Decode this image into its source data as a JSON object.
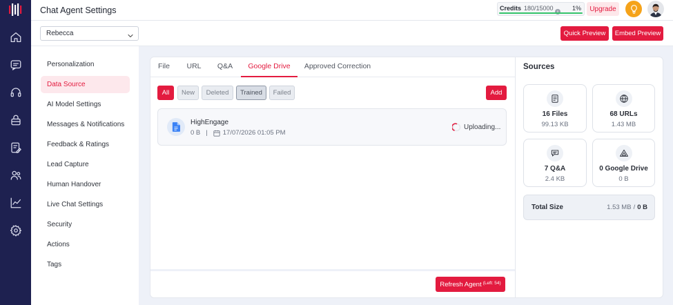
{
  "colors": {
    "primary": "#e31b3f",
    "active_bg": "#fde8ec",
    "sidebar": "#1e2150",
    "page_bg": "#eef1f8",
    "credit_bar": "#34c46a",
    "bulb": "#f5a31a"
  },
  "nav": {
    "logo": "logo-icon",
    "items": [
      {
        "icon": "home-icon"
      },
      {
        "icon": "chat-icon"
      },
      {
        "icon": "headset-icon"
      },
      {
        "icon": "bag-icon"
      },
      {
        "icon": "edit-document-icon"
      },
      {
        "icon": "users-icon"
      },
      {
        "icon": "analytics-icon"
      },
      {
        "icon": "gear-icon"
      }
    ]
  },
  "header": {
    "title": "Chat Agent Settings",
    "credits": {
      "label": "Credits",
      "value": "180/15000",
      "info_icon": "info-icon",
      "percent": "1%"
    },
    "upgrade_label": "Upgrade",
    "bulb_icon": "lightbulb-icon",
    "avatar_icon": "user-avatar"
  },
  "toolbar": {
    "agent_select": {
      "value": "Rebecca",
      "icon": "chevron-down-icon"
    },
    "quick_preview_label": "Quick Preview",
    "embed_preview_label": "Embed Preview"
  },
  "settings_menu": {
    "active_index": 1,
    "items": [
      "Personalization",
      "Data Source",
      "AI Model Settings",
      "Messages & Notifications",
      "Feedback & Ratings",
      "Lead Capture",
      "Human Handover",
      "Live Chat Settings",
      "Security",
      "Actions",
      "Tags"
    ]
  },
  "tabs": {
    "active_index": 3,
    "items": [
      "File",
      "URL",
      "Q&A",
      "Google Drive",
      "Approved Correction"
    ]
  },
  "filters": {
    "active_index": 0,
    "highlighted_index": 3,
    "items": [
      "All",
      "New",
      "Deleted",
      "Trained",
      "Failed"
    ]
  },
  "add_label": "Add",
  "files": {
    "items": [
      {
        "icon": "google-doc-icon",
        "name": "HighEngage",
        "size": "0 B",
        "separator": "|",
        "date_icon": "calendar-icon",
        "date": "17/07/2026 01:05 PM",
        "status_icon": "spinner-icon",
        "status": "Uploading..."
      }
    ]
  },
  "footer": {
    "refresh_label": "Refresh Agent",
    "refresh_remaining": "(Left: 54)"
  },
  "sources": {
    "title": "Sources",
    "cards": [
      {
        "icon": "file-icon",
        "count": "16 Files",
        "size": "99.13 KB"
      },
      {
        "icon": "globe-icon",
        "count": "68 URLs",
        "size": "1.43 MB"
      },
      {
        "icon": "qa-chat-icon",
        "count": "7 Q&A",
        "size": "2.4 KB"
      },
      {
        "icon": "google-drive-icon",
        "count": "0 Google Drive",
        "size": "0 B"
      }
    ],
    "total": {
      "label": "Total Size",
      "value": "1.53 MB",
      "separator": "/",
      "extra": "0 B"
    }
  }
}
